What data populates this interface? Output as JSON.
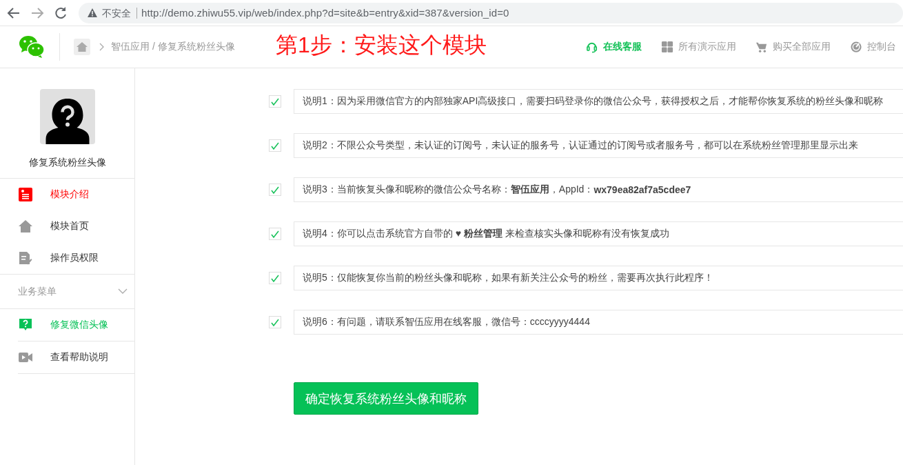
{
  "browser": {
    "security_label": "不安全",
    "url": "http://demo.zhiwu55.vip/web/index.php?d=site&b=entry&xid=387&version_id=0"
  },
  "header": {
    "breadcrumb": "智伍应用 / 修复系统粉丝头像",
    "nav": [
      {
        "label": "在线客服",
        "kind": "headset",
        "selected": true
      },
      {
        "label": "所有演示应用",
        "kind": "grid",
        "selected": false
      },
      {
        "label": "购买全部应用",
        "kind": "cart",
        "selected": false
      },
      {
        "label": "控制台",
        "kind": "gauge",
        "selected": false
      }
    ]
  },
  "annotation": "第1步：安装这个模块",
  "sidebar": {
    "title": "修复系统粉丝头像",
    "items": [
      {
        "label": "模块介绍",
        "kind": "card",
        "color": "#ff0000",
        "selected": true
      },
      {
        "label": "模块首页",
        "kind": "house",
        "color": "#999999",
        "selected": false
      },
      {
        "label": "操作员权限",
        "kind": "doc",
        "color": "#999999",
        "selected": false
      }
    ],
    "group": {
      "label": "业务菜单",
      "expanded": true,
      "items": [
        {
          "label": "修复微信头像",
          "kind": "question",
          "color": "#06c157",
          "selected": true
        },
        {
          "label": "查看帮助说明",
          "kind": "video",
          "color": "#999999",
          "selected": false
        }
      ]
    }
  },
  "notes": [
    {
      "text": "说明1：因为采用微信官方的内部独家API高级接口，需要扫码登录你的微信公众号，获得授权之后，才能帮你恢复系统的粉丝头像和昵称",
      "checked": true
    },
    {
      "text": "说明2：不限公众号类型，未认证的订阅号，未认证的服务号，认证通过的订阅号或者服务号，都可以在系统粉丝管理那里显示出来",
      "checked": true
    },
    {
      "text": "说明3：当前恢复头像和昵称的微信公众号名称：**智伍应用**，AppId：**wx79ea82af7a5cdee7**",
      "checked": true
    },
    {
      "text": "说明4：你可以点击系统官方自带的 ♥ **粉丝管理** 来检查核实头像和昵称有没有恢复成功",
      "checked": true
    },
    {
      "text": "说明5：仅能恢复你当前的粉丝头像和昵称，如果有新关注公众号的粉丝，需要再次执行此程序！",
      "checked": true
    },
    {
      "text": "说明6：有问题，请联系智伍应用在线客服，微信号：ccccyyyy4444",
      "checked": true
    }
  ],
  "submit_button": "确定恢复系统粉丝头像和昵称"
}
